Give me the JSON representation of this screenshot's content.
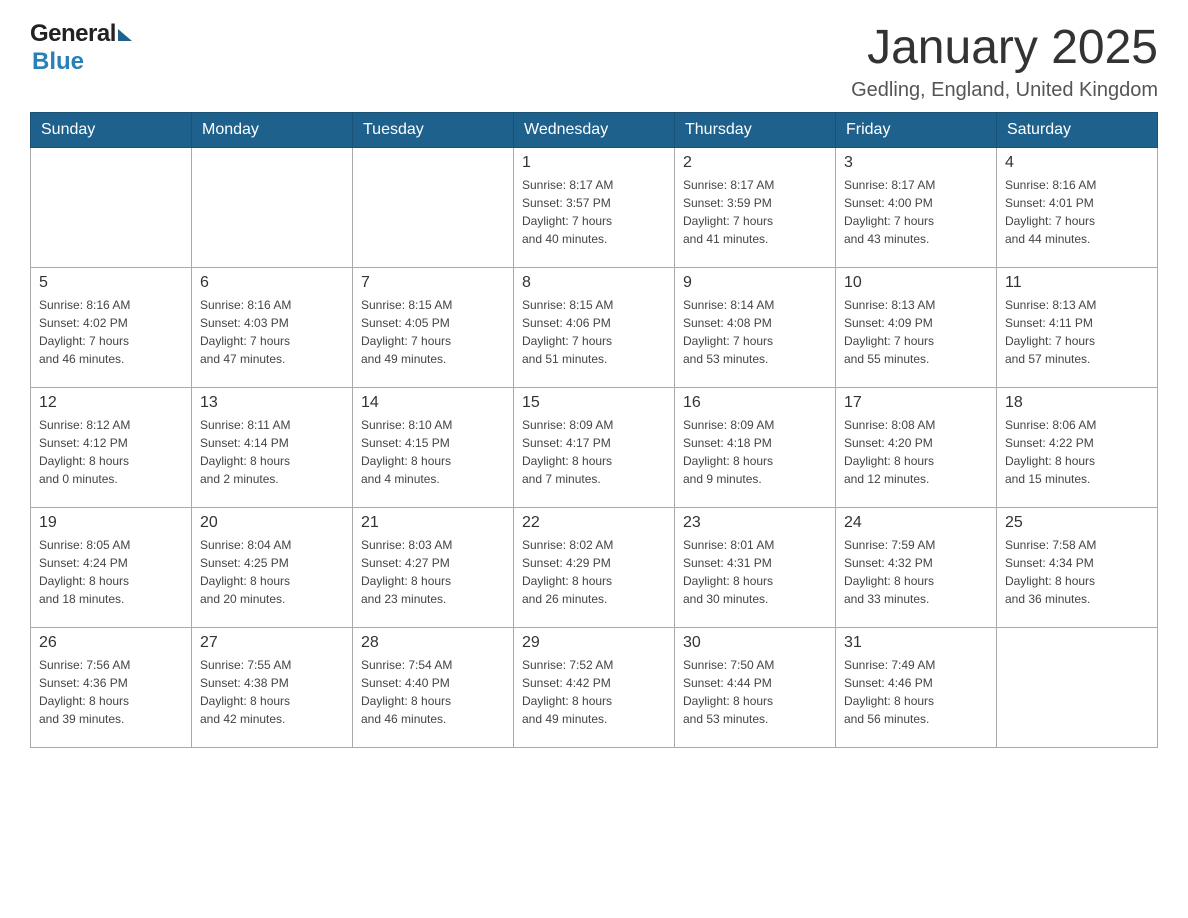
{
  "header": {
    "logo": {
      "general": "General",
      "blue": "Blue"
    },
    "title": "January 2025",
    "location": "Gedling, England, United Kingdom"
  },
  "weekdays": [
    "Sunday",
    "Monday",
    "Tuesday",
    "Wednesday",
    "Thursday",
    "Friday",
    "Saturday"
  ],
  "weeks": [
    [
      {
        "day": "",
        "info": ""
      },
      {
        "day": "",
        "info": ""
      },
      {
        "day": "",
        "info": ""
      },
      {
        "day": "1",
        "info": "Sunrise: 8:17 AM\nSunset: 3:57 PM\nDaylight: 7 hours\nand 40 minutes."
      },
      {
        "day": "2",
        "info": "Sunrise: 8:17 AM\nSunset: 3:59 PM\nDaylight: 7 hours\nand 41 minutes."
      },
      {
        "day": "3",
        "info": "Sunrise: 8:17 AM\nSunset: 4:00 PM\nDaylight: 7 hours\nand 43 minutes."
      },
      {
        "day": "4",
        "info": "Sunrise: 8:16 AM\nSunset: 4:01 PM\nDaylight: 7 hours\nand 44 minutes."
      }
    ],
    [
      {
        "day": "5",
        "info": "Sunrise: 8:16 AM\nSunset: 4:02 PM\nDaylight: 7 hours\nand 46 minutes."
      },
      {
        "day": "6",
        "info": "Sunrise: 8:16 AM\nSunset: 4:03 PM\nDaylight: 7 hours\nand 47 minutes."
      },
      {
        "day": "7",
        "info": "Sunrise: 8:15 AM\nSunset: 4:05 PM\nDaylight: 7 hours\nand 49 minutes."
      },
      {
        "day": "8",
        "info": "Sunrise: 8:15 AM\nSunset: 4:06 PM\nDaylight: 7 hours\nand 51 minutes."
      },
      {
        "day": "9",
        "info": "Sunrise: 8:14 AM\nSunset: 4:08 PM\nDaylight: 7 hours\nand 53 minutes."
      },
      {
        "day": "10",
        "info": "Sunrise: 8:13 AM\nSunset: 4:09 PM\nDaylight: 7 hours\nand 55 minutes."
      },
      {
        "day": "11",
        "info": "Sunrise: 8:13 AM\nSunset: 4:11 PM\nDaylight: 7 hours\nand 57 minutes."
      }
    ],
    [
      {
        "day": "12",
        "info": "Sunrise: 8:12 AM\nSunset: 4:12 PM\nDaylight: 8 hours\nand 0 minutes."
      },
      {
        "day": "13",
        "info": "Sunrise: 8:11 AM\nSunset: 4:14 PM\nDaylight: 8 hours\nand 2 minutes."
      },
      {
        "day": "14",
        "info": "Sunrise: 8:10 AM\nSunset: 4:15 PM\nDaylight: 8 hours\nand 4 minutes."
      },
      {
        "day": "15",
        "info": "Sunrise: 8:09 AM\nSunset: 4:17 PM\nDaylight: 8 hours\nand 7 minutes."
      },
      {
        "day": "16",
        "info": "Sunrise: 8:09 AM\nSunset: 4:18 PM\nDaylight: 8 hours\nand 9 minutes."
      },
      {
        "day": "17",
        "info": "Sunrise: 8:08 AM\nSunset: 4:20 PM\nDaylight: 8 hours\nand 12 minutes."
      },
      {
        "day": "18",
        "info": "Sunrise: 8:06 AM\nSunset: 4:22 PM\nDaylight: 8 hours\nand 15 minutes."
      }
    ],
    [
      {
        "day": "19",
        "info": "Sunrise: 8:05 AM\nSunset: 4:24 PM\nDaylight: 8 hours\nand 18 minutes."
      },
      {
        "day": "20",
        "info": "Sunrise: 8:04 AM\nSunset: 4:25 PM\nDaylight: 8 hours\nand 20 minutes."
      },
      {
        "day": "21",
        "info": "Sunrise: 8:03 AM\nSunset: 4:27 PM\nDaylight: 8 hours\nand 23 minutes."
      },
      {
        "day": "22",
        "info": "Sunrise: 8:02 AM\nSunset: 4:29 PM\nDaylight: 8 hours\nand 26 minutes."
      },
      {
        "day": "23",
        "info": "Sunrise: 8:01 AM\nSunset: 4:31 PM\nDaylight: 8 hours\nand 30 minutes."
      },
      {
        "day": "24",
        "info": "Sunrise: 7:59 AM\nSunset: 4:32 PM\nDaylight: 8 hours\nand 33 minutes."
      },
      {
        "day": "25",
        "info": "Sunrise: 7:58 AM\nSunset: 4:34 PM\nDaylight: 8 hours\nand 36 minutes."
      }
    ],
    [
      {
        "day": "26",
        "info": "Sunrise: 7:56 AM\nSunset: 4:36 PM\nDaylight: 8 hours\nand 39 minutes."
      },
      {
        "day": "27",
        "info": "Sunrise: 7:55 AM\nSunset: 4:38 PM\nDaylight: 8 hours\nand 42 minutes."
      },
      {
        "day": "28",
        "info": "Sunrise: 7:54 AM\nSunset: 4:40 PM\nDaylight: 8 hours\nand 46 minutes."
      },
      {
        "day": "29",
        "info": "Sunrise: 7:52 AM\nSunset: 4:42 PM\nDaylight: 8 hours\nand 49 minutes."
      },
      {
        "day": "30",
        "info": "Sunrise: 7:50 AM\nSunset: 4:44 PM\nDaylight: 8 hours\nand 53 minutes."
      },
      {
        "day": "31",
        "info": "Sunrise: 7:49 AM\nSunset: 4:46 PM\nDaylight: 8 hours\nand 56 minutes."
      },
      {
        "day": "",
        "info": ""
      }
    ]
  ]
}
